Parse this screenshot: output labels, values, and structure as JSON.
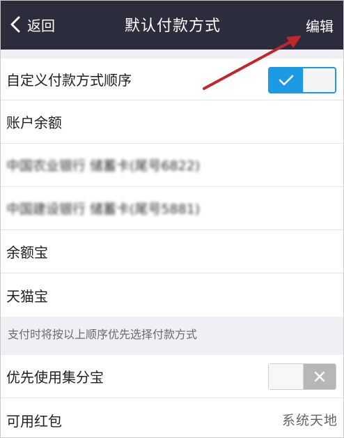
{
  "navbar": {
    "back_label": "返回",
    "title": "默认付款方式",
    "edit_label": "编辑"
  },
  "section1": {
    "custom_order": {
      "label": "自定义付款方式顺序",
      "enabled": true
    },
    "items": [
      {
        "label": "账户余额"
      },
      {
        "label": "中国农业银行 储蓄卡(尾号6822)",
        "obscured": true
      },
      {
        "label": "中国建设银行 储蓄卡(尾号5881)",
        "obscured": true
      },
      {
        "label": "余额宝"
      },
      {
        "label": "天猫宝"
      }
    ]
  },
  "footnote": "支付时将按以上顺序优先选择付款方式",
  "section2": {
    "jifenbao": {
      "label": "优先使用集分宝",
      "enabled": false
    },
    "hongbao": {
      "label": "可用红包"
    }
  },
  "watermark": "系统天地",
  "colors": {
    "navbar_bg": "#2b2d3c",
    "toggle_on": "#1c9ae4",
    "annotation_arrow": "#c0262b",
    "page_bg": "#f0eff4"
  }
}
